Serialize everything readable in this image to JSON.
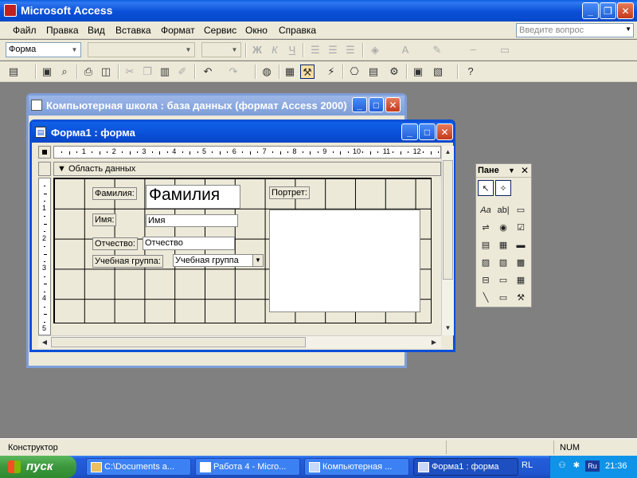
{
  "app": {
    "title": "Microsoft Access"
  },
  "menu": [
    {
      "label": "Файл"
    },
    {
      "label": "Правка"
    },
    {
      "label": "Вид"
    },
    {
      "label": "Вставка"
    },
    {
      "label": "Формат"
    },
    {
      "label": "Сервис"
    },
    {
      "label": "Окно"
    },
    {
      "label": "Справка"
    }
  ],
  "help_box": {
    "placeholder": "Введите вопрос"
  },
  "toolbar1": {
    "object_combo": "Форма",
    "font_combo": "",
    "size_combo": ""
  },
  "db_window": {
    "title": "Компьютерная школа : база данных (формат Access 2000)"
  },
  "form_window": {
    "title": "Форма1 : форма"
  },
  "ruler": {
    "h_numbers": [
      "1",
      "2",
      "3",
      "4",
      "5",
      "6",
      "7",
      "8",
      "9",
      "10",
      "11",
      "12"
    ],
    "v_numbers": [
      "1",
      "2",
      "3",
      "4",
      "5"
    ]
  },
  "section": {
    "label": "Область данных"
  },
  "controls": {
    "lbl_familia": "Фамилия:",
    "txt_familia": "Фамилия",
    "lbl_imya": "Имя:",
    "txt_imya": "Имя",
    "lbl_otchestvo": "Отчество:",
    "txt_otchestvo": "Отчество",
    "lbl_group": "Учебная группа:",
    "cmb_group": "Учебная группа",
    "lbl_portret": "Портрет:"
  },
  "toolbox": {
    "title": "Пане"
  },
  "status": {
    "left": "Конструктор",
    "num": "NUM"
  },
  "taskbar": {
    "start": "пуск",
    "tasks": [
      {
        "label": "C:\\Documents a..."
      },
      {
        "label": "Работа 4 - Micro..."
      },
      {
        "label": "Компьютерная ..."
      },
      {
        "label": "Форма1 : форма"
      }
    ],
    "lang": "RL",
    "tray_lang": "Ru",
    "clock": "21:36"
  },
  "colors": {
    "titlebar": "#0a4fd8",
    "taskbar": "#245edb",
    "start": "#3c963c",
    "chrome": "#ece9d8",
    "desktop": "#808080"
  }
}
